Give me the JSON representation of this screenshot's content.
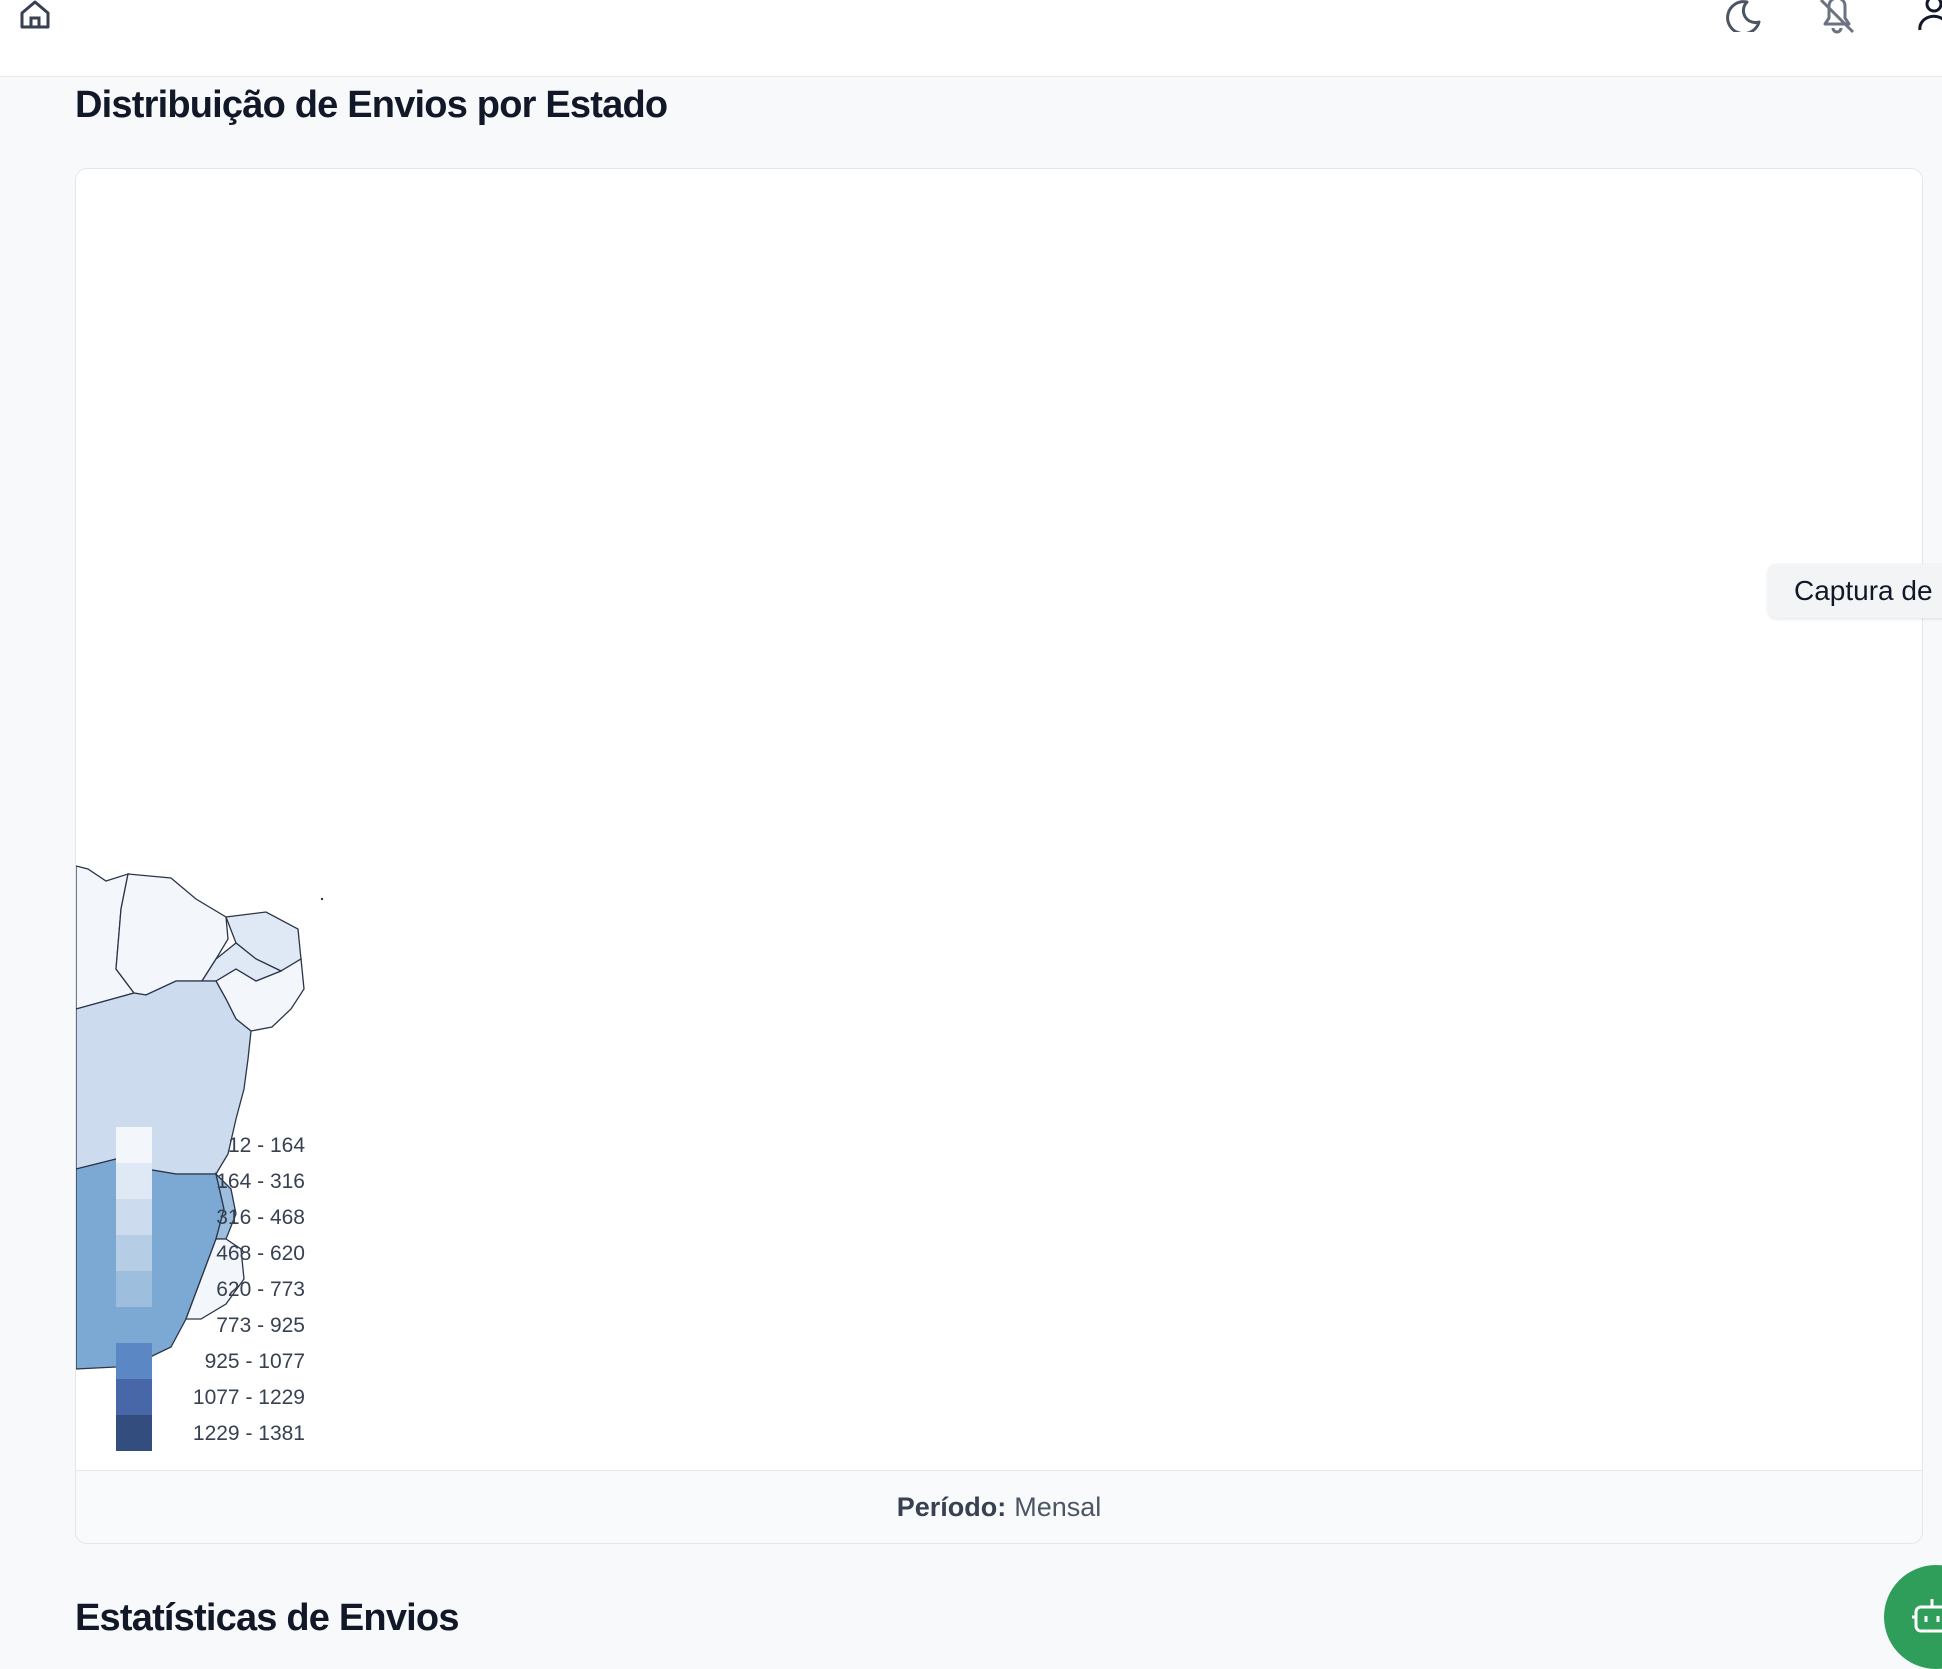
{
  "topbar": {
    "icons": [
      "home-icon",
      "moon-icon",
      "bell-off-icon",
      "user-icon"
    ]
  },
  "map_section": {
    "title": "Distribuição de Envios por Estado",
    "legend": [
      {
        "range": "12 - 164",
        "color": "#f3f7fc"
      },
      {
        "range": "164 - 316",
        "color": "#dfe9f5"
      },
      {
        "range": "316 - 468",
        "color": "#ccdcee"
      },
      {
        "range": "468 - 620",
        "color": "#b5cee6"
      },
      {
        "range": "620 - 773",
        "color": "#9dbedd"
      },
      {
        "range": "773 - 925",
        "color": "#7ba9d3"
      },
      {
        "range": "925 - 1077",
        "color": "#5b88c4"
      },
      {
        "range": "1077 - 1229",
        "color": "#4867a9"
      },
      {
        "range": "1229 - 1381",
        "color": "#344d7f"
      }
    ],
    "footer": {
      "label": "Período:",
      "value": "Mensal"
    }
  },
  "tooltip": {
    "text": "Captura de"
  },
  "stats_section": {
    "title": "Estatísticas de Envios"
  },
  "assistant": {
    "icon": "robot-icon",
    "color": "#2f9e5a"
  }
}
